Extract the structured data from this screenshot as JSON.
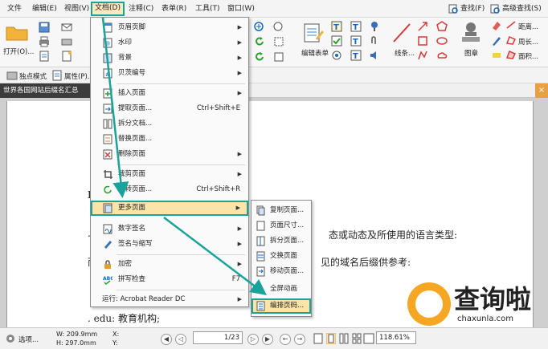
{
  "menubar": {
    "items": [
      "文件",
      "编辑(E)",
      "视图(V)",
      "文档(D)",
      "注释(C)",
      "表单(R)",
      "工具(T)",
      "窗口(W)"
    ],
    "right": {
      "find": "查找(F)",
      "advanced_find": "高级查找(S)"
    }
  },
  "ribbon": {
    "open": "打开(O)...",
    "edit_form": "编辑表单",
    "line": "线条...",
    "stamp": "图章",
    "distance": "距离...",
    "perimeter": "周长...",
    "area": "面积..."
  },
  "quickbar": {
    "standalone_mode": "独点模式",
    "properties": "属性(P)..."
  },
  "doc_tab": {
    "title": "世界各国网站后缀名汇总",
    "close": "×"
  },
  "document": {
    "line1": "态或动态及所使用的语言类型:",
    "line2": "见的域名后缀供参考:",
    "line3": ". edu: 教育机构;",
    "frag_b": "B",
    "frag_dot": ".",
    "frag_n": "而"
  },
  "menu": {
    "items": [
      {
        "label": "页眉页脚",
        "shortcut": "",
        "arrow": "▶"
      },
      {
        "label": "水印",
        "shortcut": "",
        "arrow": "▶"
      },
      {
        "label": "背景",
        "shortcut": "",
        "arrow": "▶"
      },
      {
        "label": "贝茨编号",
        "shortcut": "",
        "arrow": "▶"
      },
      {
        "label": "插入页面",
        "shortcut": "",
        "arrow": "▶"
      },
      {
        "label": "提取页面...",
        "shortcut": "Ctrl+Shift+E",
        "arrow": ""
      },
      {
        "label": "拆分文档...",
        "shortcut": "",
        "arrow": ""
      },
      {
        "label": "替换页面...",
        "shortcut": "",
        "arrow": ""
      },
      {
        "label": "删除页面",
        "shortcut": "",
        "arrow": "▶"
      },
      {
        "label": "裁剪页面",
        "shortcut": "",
        "arrow": "▶"
      },
      {
        "label": "旋转页面...",
        "shortcut": "Ctrl+Shift+R",
        "arrow": ""
      },
      {
        "label": "更多页面",
        "shortcut": "",
        "arrow": "▶"
      },
      {
        "label": "数字签名",
        "shortcut": "",
        "arrow": "▶"
      },
      {
        "label": "签名与缩写",
        "shortcut": "",
        "arrow": "▶"
      },
      {
        "label": "加密",
        "shortcut": "",
        "arrow": "▶"
      },
      {
        "label": "拼写检查",
        "shortcut": "F7",
        "arrow": ""
      },
      {
        "label": "运行: Acrobat Reader DC",
        "shortcut": "",
        "arrow": "▶"
      }
    ]
  },
  "submenu": {
    "items": [
      "复制页面...",
      "页面尺寸...",
      "拆分页面...",
      "交换页面",
      "移动页面...",
      "全屏动画",
      "编排页码..."
    ]
  },
  "status": {
    "options": "选项...",
    "width": "W: 209.9mm",
    "height": "H: 297.0mm",
    "x": "X:",
    "y": "Y:",
    "page": "1/23",
    "zoom": "118.61%"
  },
  "watermark": {
    "text": "查询啦",
    "url": "chaxunla.com"
  },
  "colors": {
    "accent_teal": "#1aa39a",
    "highlight": "#fce3a8",
    "doc_tab_bg": "#3c3c3c",
    "tab_close": "#e8a040"
  }
}
